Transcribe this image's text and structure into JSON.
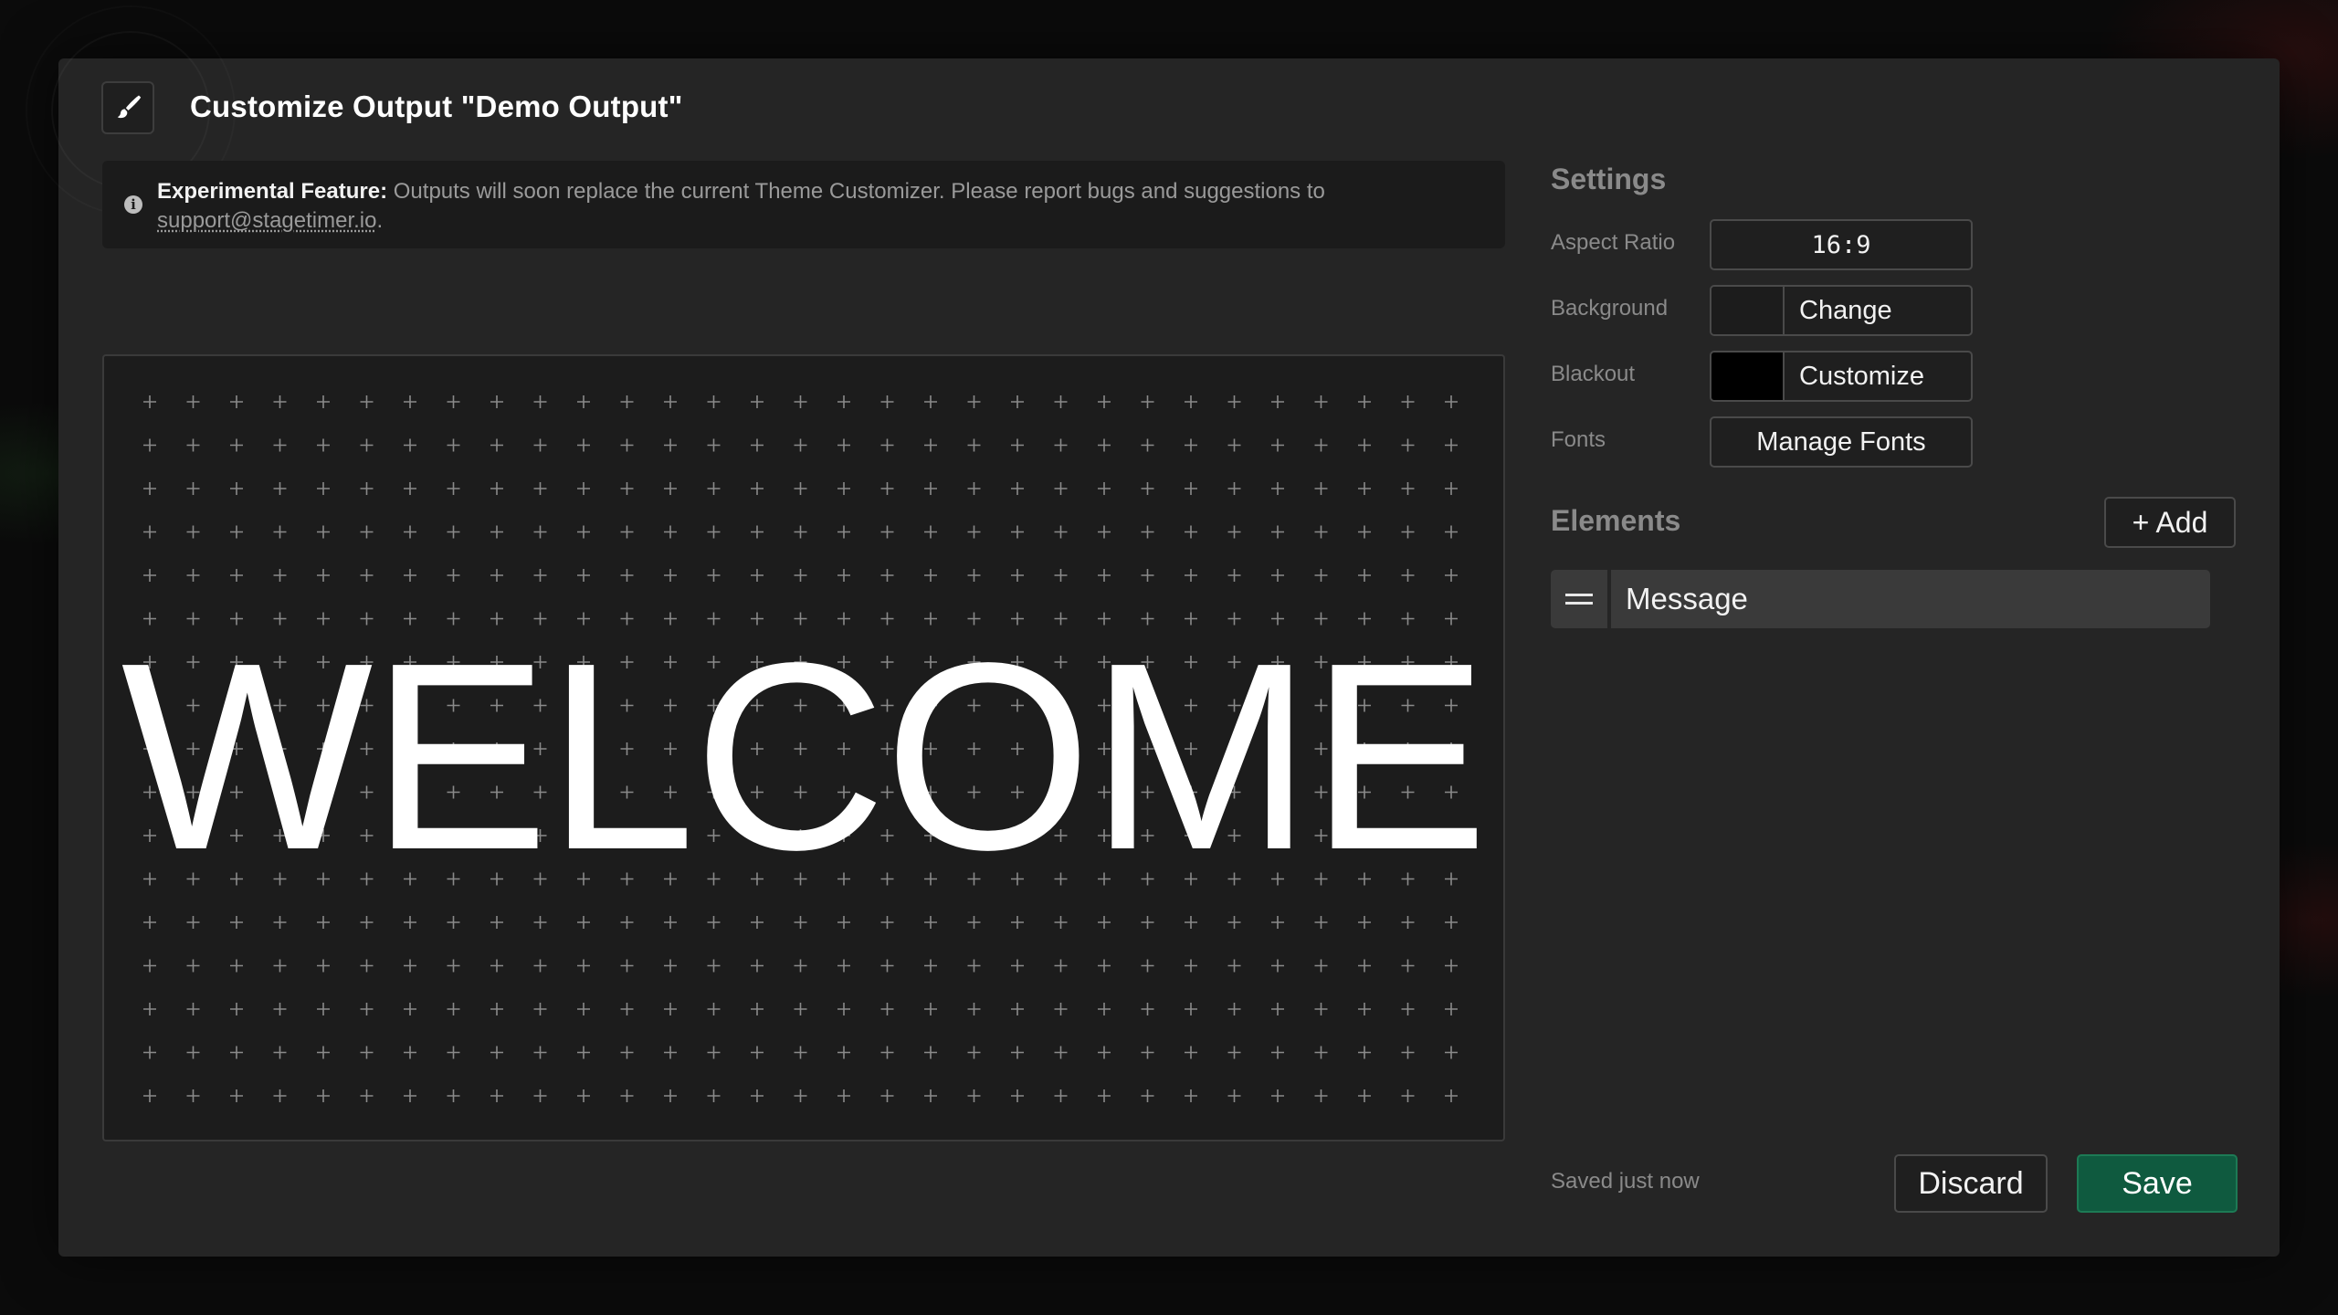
{
  "dialog": {
    "title": "Customize Output \"Demo Output\"",
    "header_icon": "paintbrush-icon"
  },
  "notice": {
    "icon": "info-icon",
    "label": "Experimental Feature:",
    "text": " Outputs will soon replace the current Theme Customizer. Please report bugs and suggestions to ",
    "email": "support@stagetimer.io",
    "suffix": "."
  },
  "preview": {
    "message": "WELCOME"
  },
  "settings": {
    "title": "Settings",
    "aspect_ratio": {
      "label": "Aspect Ratio",
      "value": "16:9"
    },
    "background": {
      "label": "Background",
      "button": "Change",
      "color": "#1c1c1c"
    },
    "blackout": {
      "label": "Blackout",
      "button": "Customize",
      "color": "#000000"
    },
    "fonts": {
      "label": "Fonts",
      "button": "Manage Fonts"
    }
  },
  "elements": {
    "title": "Elements",
    "add_button": "+ Add",
    "items": [
      {
        "label": "Message"
      }
    ]
  },
  "footer": {
    "status": "Saved just now",
    "discard": "Discard",
    "save": "Save"
  },
  "colors": {
    "accent_save": "#0f5a3f",
    "panel": "#252525",
    "canvas": "#1c1c1c"
  }
}
